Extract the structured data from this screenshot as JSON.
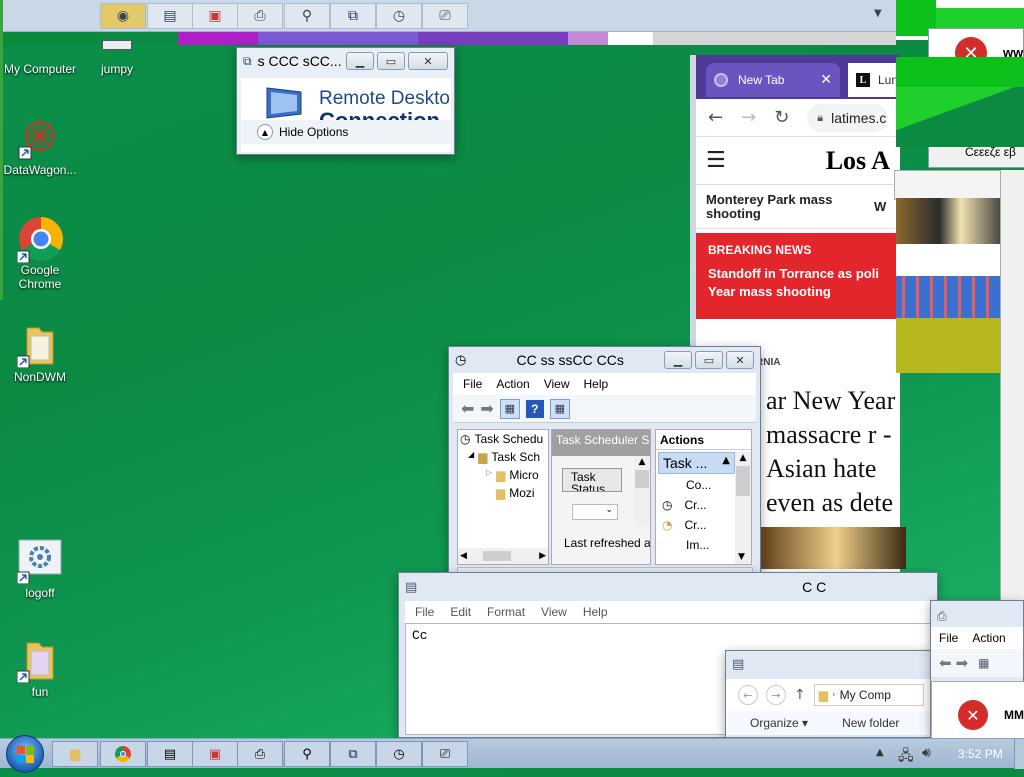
{
  "desktop": {
    "icons": [
      {
        "label": "My Computer"
      },
      {
        "label": "jumpy"
      },
      {
        "label": "DataWagon..."
      },
      {
        "label": "Google Chrome"
      },
      {
        "label": "NonDWM"
      },
      {
        "label": "logoff"
      },
      {
        "label": "fun"
      }
    ]
  },
  "rdp_window": {
    "title": "s CCC sCC...",
    "heading1": "Remote Deskto",
    "heading2": "Connection",
    "hide_options": "Hide Options"
  },
  "browser": {
    "tab_label": "New Tab",
    "tab2_label": "Lun",
    "url": "latimes.c",
    "logo": "Los A",
    "nav_headline": "Monterey Park mass shooting",
    "nav_w": "W",
    "breaking_label": "BREAKING NEWS",
    "breaking_text": "Standoff in Torrance as poli Year mass shooting",
    "section_label": "RNIA",
    "headline": "ar New Year massacre r -Asian hate even as dete ive"
  },
  "task_scheduler": {
    "title": "CC ss ssCC CCs",
    "menu": [
      "File",
      "Action",
      "View",
      "Help"
    ],
    "tree": [
      "Task Schedu",
      "Task Sch",
      "Micro",
      "Mozi"
    ],
    "center_header": "Task Scheduler Su",
    "task_status": "Task Status",
    "last_refreshed": "Last refreshed at",
    "actions_header": "Actions",
    "actions_sub": "Task ...",
    "actions_items": [
      "Co...",
      "Cr...",
      "Cr...",
      "Im..."
    ]
  },
  "notepad": {
    "title": "C C",
    "menu": [
      "File",
      "Edit",
      "Format",
      "View",
      "Help"
    ],
    "content": "Cc"
  },
  "explorer": {
    "address": "My Comp",
    "organize": "Organize ▾",
    "new_folder": "New folder"
  },
  "mmc_small": {
    "menu": [
      "File",
      "Action"
    ],
    "error_text": "MM"
  },
  "error_top": {
    "text": "ww",
    "strip_text": "Cεεεζε εβ"
  },
  "taskbar": {
    "clock": "3:52 PM"
  },
  "colors": {
    "desktop_green": "#0b8a44",
    "breaking_red": "#e3262b",
    "error_red": "#d42b2b"
  }
}
